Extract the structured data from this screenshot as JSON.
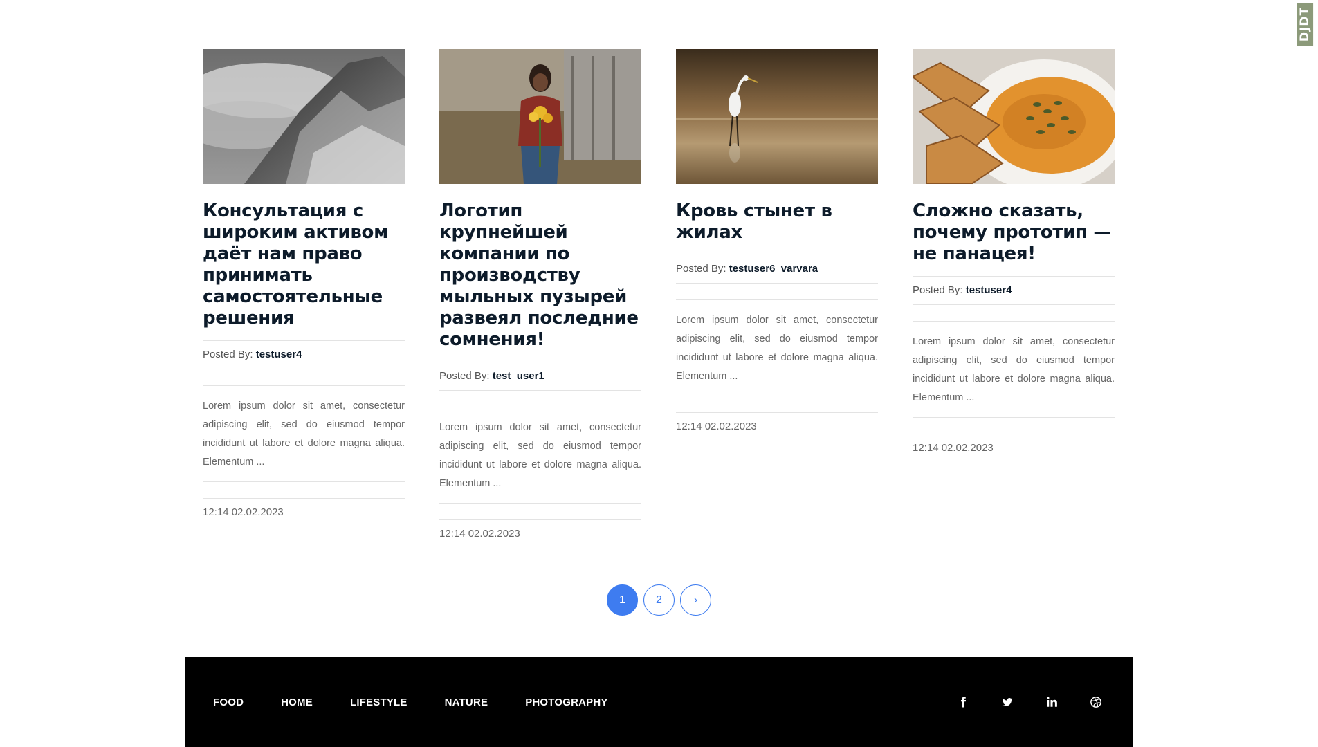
{
  "debug_toolbar": {
    "label": "DJDT"
  },
  "posts": [
    {
      "title": "Консультация с широким активом даёт нам право принимать самостоятельные решения",
      "posted_by_label": "Posted By:",
      "author": "testuser4",
      "excerpt": "Lorem ipsum dolor sit amet, consectetur adipiscing elit, sed do eiusmod tempor incididunt ut labore et dolore magna aliqua. Elementum ...",
      "date": "12:14 02.02.2023",
      "image": "mountain-fog"
    },
    {
      "title": "Логотип крупнейшей компании по производству мыльных пузырей развеял последние сомнения!",
      "posted_by_label": "Posted By:",
      "author": "test_user1",
      "excerpt": "Lorem ipsum dolor sit amet, consectetur adipiscing elit, sed do eiusmod tempor incididunt ut labore et dolore magna aliqua. Elementum ...",
      "date": "12:14 02.02.2023",
      "image": "woman-with-flowers"
    },
    {
      "title": "Кровь стынет в жилах",
      "posted_by_label": "Posted By:",
      "author": "testuser6_varvara",
      "excerpt": "Lorem ipsum dolor sit amet, consectetur adipiscing elit, sed do eiusmod tempor incididunt ut labore et dolore magna aliqua. Elementum ...",
      "date": "12:14 02.02.2023",
      "image": "heron-in-water"
    },
    {
      "title": "Сложно сказать, почему прототип — не панацея!",
      "posted_by_label": "Posted By:",
      "author": "testuser4",
      "excerpt": "Lorem ipsum dolor sit amet, consectetur adipiscing elit, sed do eiusmod tempor incididunt ut labore et dolore magna aliqua. Elementum ...",
      "date": "12:14 02.02.2023",
      "image": "soup-with-bread"
    }
  ],
  "pagination": {
    "pages": [
      "1",
      "2"
    ],
    "next": "›",
    "current": "1"
  },
  "footer": {
    "nav": [
      "FOOD",
      "HOME",
      "LIFESTYLE",
      "NATURE",
      "PHOTOGRAPHY"
    ],
    "socials": [
      "facebook-icon",
      "twitter-icon",
      "linkedin-icon",
      "dribbble-icon"
    ]
  },
  "colors": {
    "accent": "#3e7cf0",
    "footer_bg": "#000000",
    "title": "#0d1b2a"
  }
}
